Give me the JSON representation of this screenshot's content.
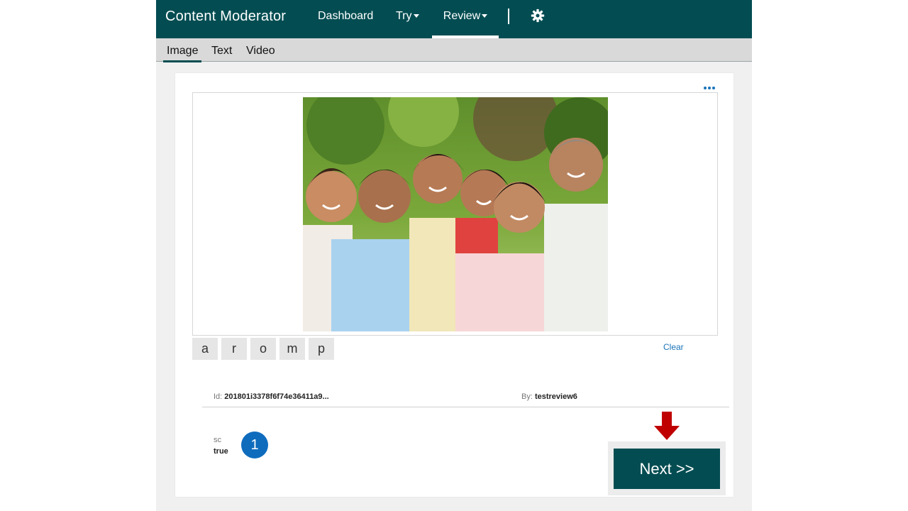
{
  "app": {
    "title": "Content Moderator"
  },
  "nav": {
    "items": [
      {
        "label": "Dashboard"
      },
      {
        "label": "Try"
      },
      {
        "label": "Review"
      }
    ],
    "settings_icon": "gear-icon"
  },
  "subnav": {
    "tabs": [
      {
        "label": "Image"
      },
      {
        "label": "Text"
      },
      {
        "label": "Video"
      }
    ]
  },
  "review": {
    "image_alt": "Family photo of six smiling people outdoors",
    "tags": [
      "a",
      "r",
      "o",
      "m",
      "p"
    ],
    "clear_label": "Clear",
    "id_label": "Id:",
    "id_value": "201801i3378f6f74e36411a9...",
    "by_label": "By:",
    "by_value": "testreview6",
    "tag_key": "sc",
    "tag_value": "true",
    "callout_number": "1",
    "next_label": "Next >>"
  },
  "colors": {
    "brand": "#034d52",
    "accent": "#1a73b8",
    "callout": "#0f6cbd",
    "arrow": "#c00000"
  }
}
